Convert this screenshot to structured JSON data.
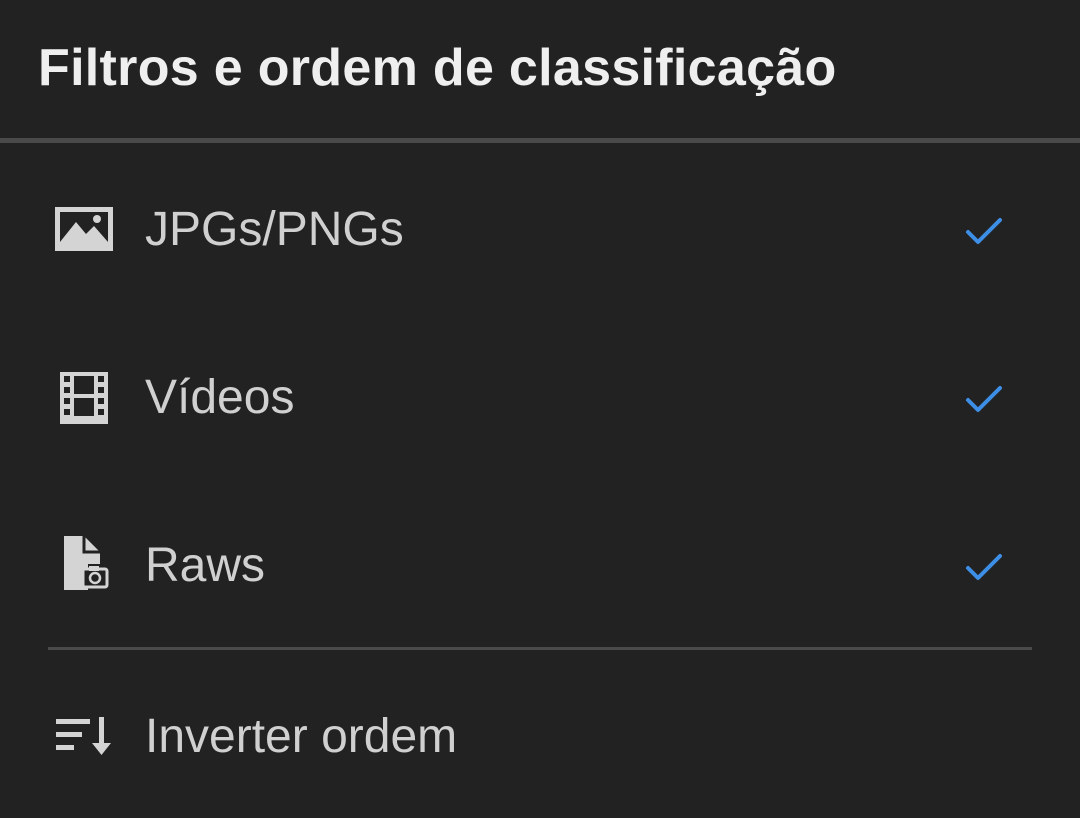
{
  "header": {
    "title": "Filtros e ordem de classificação"
  },
  "filters": [
    {
      "label": "JPGs/PNGs",
      "icon": "image-icon",
      "checked": true
    },
    {
      "label": "Vídeos",
      "icon": "film-icon",
      "checked": true
    },
    {
      "label": "Raws",
      "icon": "raw-file-icon",
      "checked": true
    }
  ],
  "sort": {
    "label": "Inverter ordem",
    "icon": "sort-order-icon"
  },
  "colors": {
    "background": "#222222",
    "divider": "#4a4a4a",
    "title": "#efefef",
    "text": "#d0d0d0",
    "icon": "#d4d4d4",
    "check": "#3d8ee6"
  }
}
